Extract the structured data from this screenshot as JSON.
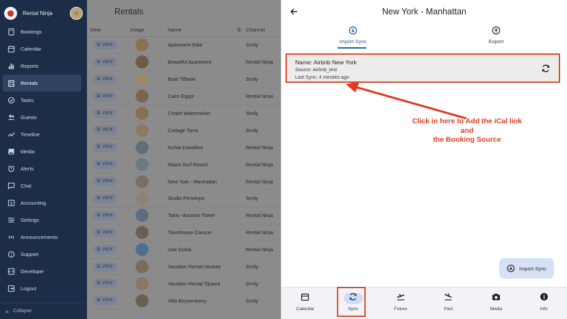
{
  "sidebar": {
    "brand": "Rental Ninja",
    "items": [
      {
        "label": "Bookings",
        "icon": "book-icon"
      },
      {
        "label": "Calendar",
        "icon": "calendar-icon"
      },
      {
        "label": "Reports",
        "icon": "bar-chart-icon"
      },
      {
        "label": "Rentals",
        "icon": "building-icon",
        "active": true
      },
      {
        "label": "Tasks",
        "icon": "check-circle-icon"
      },
      {
        "label": "Guests",
        "icon": "people-icon"
      },
      {
        "label": "Timeline",
        "icon": "trend-icon"
      },
      {
        "label": "Media",
        "icon": "image-icon"
      },
      {
        "label": "Alerts",
        "icon": "alarm-icon"
      },
      {
        "label": "Chat",
        "icon": "chat-icon"
      },
      {
        "label": "Accounting",
        "icon": "dollar-icon"
      },
      {
        "label": "Settings",
        "icon": "sliders-icon"
      },
      {
        "label": "Announcements",
        "icon": "broadcast-icon"
      },
      {
        "label": "Support",
        "icon": "help-icon"
      },
      {
        "label": "Developer",
        "icon": "code-icon"
      },
      {
        "label": "Logout",
        "icon": "logout-icon"
      }
    ],
    "collapse_label": "Collapse"
  },
  "rentals": {
    "title": "Rentals",
    "columns": {
      "view": "View",
      "image": "Image",
      "name": "Name",
      "channel": "Channel"
    },
    "view_label": "VIEW",
    "rows": [
      {
        "name": "Apartment Edie",
        "channel": "Smily"
      },
      {
        "name": "Beautiful Apartment",
        "channel": "Rental Ninja"
      },
      {
        "name": "Boat Tiffanie",
        "channel": "Smily"
      },
      {
        "name": "Cairo Egypt",
        "channel": "Rental Ninja"
      },
      {
        "name": "Chalet Watermelon",
        "channel": "Smily"
      },
      {
        "name": "Cottage Tarra",
        "channel": "Smily"
      },
      {
        "name": "Ischia Coastline",
        "channel": "Rental Ninja"
      },
      {
        "name": "Miami Surf Resort",
        "channel": "Rental Ninja"
      },
      {
        "name": "New York - Manhattan",
        "channel": "Rental Ninja"
      },
      {
        "name": "Studio Penelope",
        "channel": "Smily"
      },
      {
        "name": "Tokio -docomo Tower",
        "channel": "Rental Ninja"
      },
      {
        "name": "Townhouse Cancun",
        "channel": "Rental Ninja"
      },
      {
        "name": "Uae Dubai",
        "channel": "Rental Ninja"
      },
      {
        "name": "Vacation Rental Hockey",
        "channel": "Smily"
      },
      {
        "name": "Vacation Rental Tijuana",
        "channel": "Smily"
      },
      {
        "name": "Villa Boysenberry",
        "channel": "Smily"
      }
    ]
  },
  "detail": {
    "title": "New York - Manhattan",
    "tabs": {
      "import": "Import Sync",
      "export": "Export"
    },
    "sync": {
      "name": "Name: Airbnb New York",
      "source": "Source: Airbnb_test",
      "last_sync": "Last Sync: 4 minutes ago"
    },
    "annotation": {
      "line1": "Click in here to Add the iCal link",
      "line2": "and",
      "line3": "the Booking Source"
    },
    "fab_label": "Import Sync",
    "bottom_nav": [
      {
        "label": "Calendar",
        "icon": "calendar-icon"
      },
      {
        "label": "Sync",
        "icon": "sync-icon",
        "active": true
      },
      {
        "label": "Future",
        "icon": "plane-departure-icon"
      },
      {
        "label": "Past",
        "icon": "plane-arrival-icon"
      },
      {
        "label": "Media",
        "icon": "camera-icon"
      },
      {
        "label": "Info",
        "icon": "info-icon"
      }
    ]
  },
  "colors": {
    "sidebar_bg": "#1c2d47",
    "accent": "#2d5f9e",
    "annotation_red": "#e03a21"
  }
}
